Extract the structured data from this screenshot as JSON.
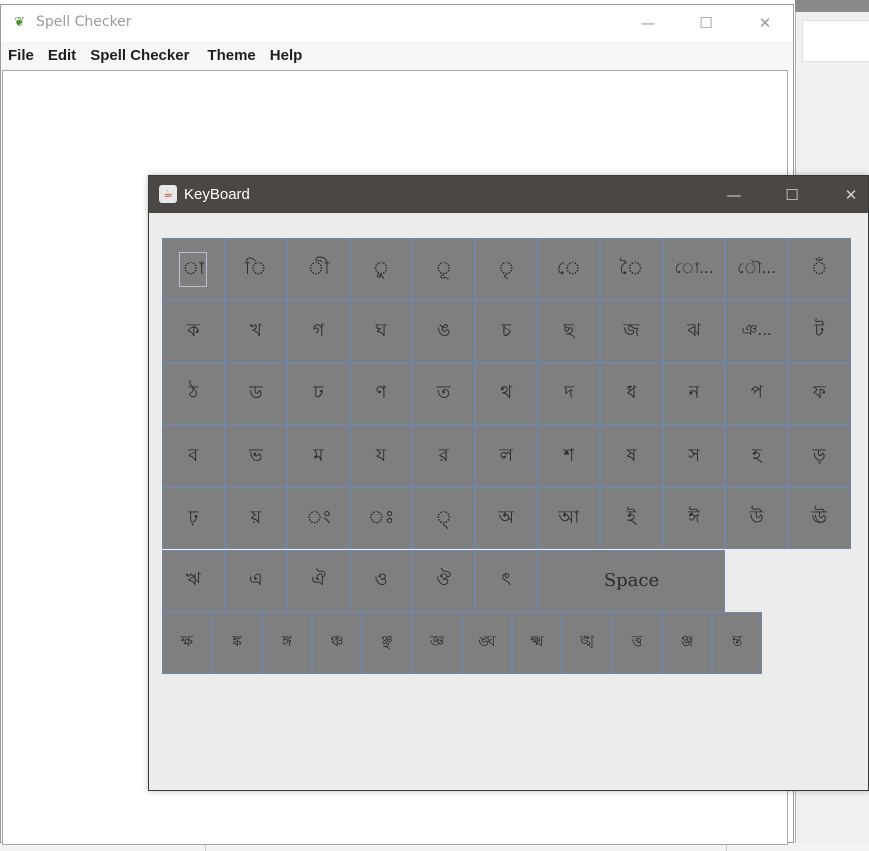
{
  "main_window": {
    "title": "Spell Checker",
    "menu": [
      "File",
      "Edit",
      "Spell Checker",
      "Theme",
      "Help"
    ],
    "controls": {
      "minimize": "—",
      "maximize": "☐",
      "close": "✕"
    }
  },
  "keyboard_window": {
    "title": "KeyBoard",
    "controls": {
      "minimize": "—",
      "maximize": "☐",
      "close": "✕"
    },
    "rows": [
      [
        "া",
        "ি",
        "ী",
        "ু",
        "ূ",
        "ৃ",
        "ে",
        "ৈ",
        "ো...",
        "ৌ...",
        "ঁ"
      ],
      [
        "ক",
        "খ",
        "গ",
        "ঘ",
        "ঙ",
        "চ",
        "ছ",
        "জ",
        "ঝ",
        "ঞ...",
        "ট"
      ],
      [
        "ঠ",
        "ড",
        "ঢ",
        "ণ",
        "ত",
        "থ",
        "দ",
        "ধ",
        "ন",
        "প",
        "ফ"
      ],
      [
        "ব",
        "ভ",
        "ম",
        "য",
        "র",
        "ল",
        "শ",
        "ষ",
        "স",
        "হ",
        "ড়"
      ],
      [
        "ঢ়",
        "য়",
        "ং",
        "ঃ",
        "্",
        "অ",
        "আ",
        "ই",
        "ঈ",
        "উ",
        "ঊ"
      ],
      [
        "ঋ",
        "এ",
        "ঐ",
        "ও",
        "ঔ",
        "ৎ"
      ],
      [
        "ক্ষ",
        "ঙ্ক",
        "ঙ্গ",
        "ঞ্চ",
        "ঞ্ছ",
        "জ্ঞ",
        "ঙ্ঘ",
        "ক্ষ্ম",
        "ঙ্খ",
        "ত্ত",
        "ঞ্জ",
        "ন্ত"
      ]
    ],
    "space_label": "Space"
  }
}
